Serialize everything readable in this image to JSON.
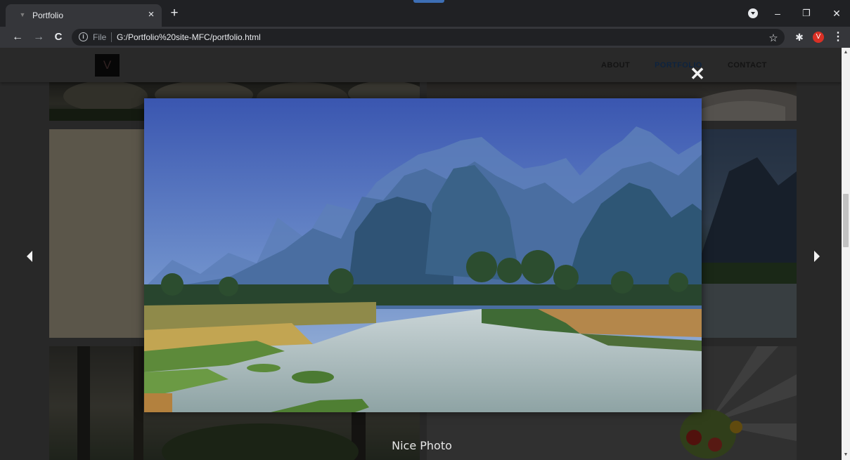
{
  "browser": {
    "tab_title": "Portfolio",
    "tab_close_glyph": "×",
    "new_tab_glyph": "+",
    "omnibox_scheme": "File",
    "omnibox_info_glyph": "i",
    "url": "G:/Portfolio%20site-MFC/portfolio.html",
    "back_glyph": "←",
    "forward_glyph": "→",
    "reload_glyph": "C",
    "star_glyph": "☆",
    "extensions_glyph": "✱",
    "profile_initial": "V",
    "menu_glyph": "⋮",
    "minimize_glyph": "–",
    "restore_glyph": "❐",
    "close_glyph": "✕",
    "favicon_glyph": "▼",
    "icons": [
      "tab-search-icon",
      "bookmark-star-icon",
      "extensions-puzzle-icon",
      "kebab-menu-icon"
    ]
  },
  "site": {
    "logo_glyph": "V",
    "nav": [
      {
        "label": "ABOUT",
        "active": false
      },
      {
        "label": "PORTFOLIO",
        "active": true
      },
      {
        "label": "CONTACT",
        "active": false
      }
    ],
    "accent_color": "#2f6db5"
  },
  "lightbox": {
    "close_glyph": "✕",
    "caption": "Nice Photo",
    "icons": [
      "close-icon",
      "arrow-left-icon",
      "arrow-right-icon"
    ]
  },
  "scrollbar": {
    "up_glyph": "▲",
    "down_glyph": "▼"
  }
}
